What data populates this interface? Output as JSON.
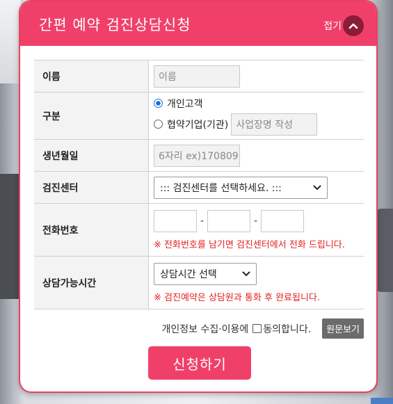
{
  "header": {
    "title": "간편 예약 검진상담신청",
    "fold_label": "접기"
  },
  "form": {
    "name": {
      "label": "이름",
      "placeholder": "이름"
    },
    "type": {
      "label": "구분",
      "option_personal": "개인고객",
      "option_partner": "협약기업(기관)",
      "partner_placeholder": "사업장명 작성",
      "selected": "개인고객"
    },
    "birth": {
      "label": "생년월일",
      "placeholder": "6자리 ex)170809"
    },
    "center": {
      "label": "검진센터",
      "selected": "::: 검진센터를 선택하세요. :::"
    },
    "phone": {
      "label": "전화번호",
      "separator": "-",
      "notice": "※ 전화번호를 남기면 검진센터에서 전화 드립니다."
    },
    "time": {
      "label": "상담가능시간",
      "selected": "상담시간 선택",
      "notice": "※ 검진예약은 상담원과 통화 후 완료됩니다."
    }
  },
  "agreement": {
    "text": "개인정보 수집·이용에",
    "checkbox_label": "동의합니다.",
    "view_button": "원문보기",
    "checked": false
  },
  "submit_label": "신청하기",
  "colors": {
    "accent": "#f0406a",
    "fold_button": "#8b1c38",
    "notice": "#e21f1f"
  }
}
